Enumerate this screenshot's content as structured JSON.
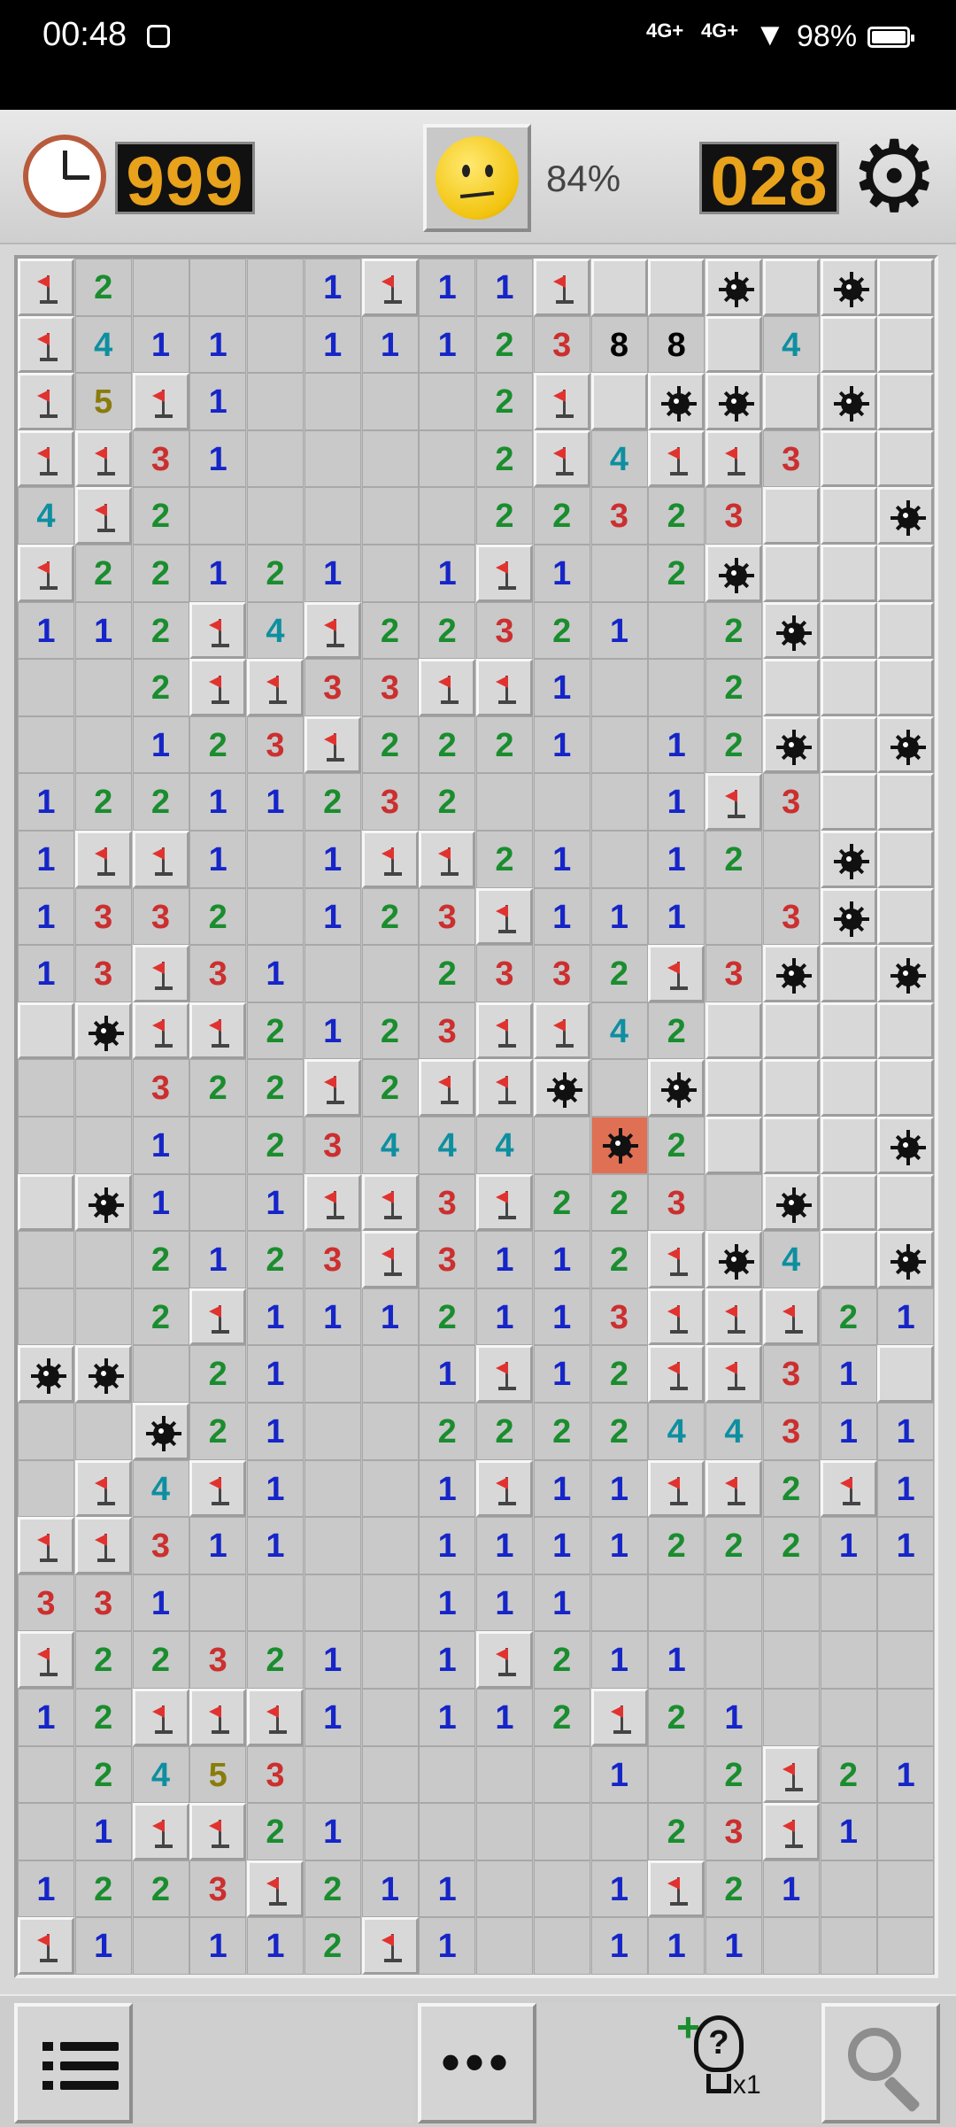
{
  "status_bar": {
    "time": "00:48",
    "signal1": "4G+",
    "signal2": "4G+",
    "battery": "98%"
  },
  "header": {
    "timer": "999",
    "mines_left": "028",
    "progress": "84%",
    "face_state": "worried",
    "icons": [
      "clock-icon",
      "face-icon",
      "gear-icon"
    ]
  },
  "board": {
    "cols": 16,
    "rows": 30,
    "legend": "F=flag, M=mine, X=exploded mine, .=unopened, _=empty open, digits=adjacent count",
    "cells": [
      "F2___1F11F..M.M.",
      "F411_1112388.4..",
      "F5F1____2F.MM.M.",
      "FF31____2F4FF3..",
      "4F2_____22323..M",
      "F22121_1F1_2M...",
      "112F4F22321_2M..",
      "__2FF33FF1__2...",
      "__123F2221_12M.M",
      "12211232___1F3..",
      "1FF1_1FF21_12_M.",
      "1332_123F111_3M..",
      "13F31__2332F3M.M",
      ".MFF2123FF42....",
      "__322F2FFM_M....",
      "__1_23444_X2...M",
      ".M1_1FF3F223_M..",
      "__2123F3112FM4.M",
      "__2F1112113FFF21",
      "MM_21__1F12FF31.",
      "__M21__22224431 1",
      "_F4F1__1F11FF2F1",
      "FF311__111122211",
      "331____111______",
      "F22321_1F211____",
      "12FFF1_112F21___",
      "_2453_____1_2F21_",
      "_1FF21_____23F1__",
      "1223F211__1F21__",
      "F1_112F1__111___"
    ]
  },
  "bottom_bar": {
    "hint_count": "x1"
  }
}
